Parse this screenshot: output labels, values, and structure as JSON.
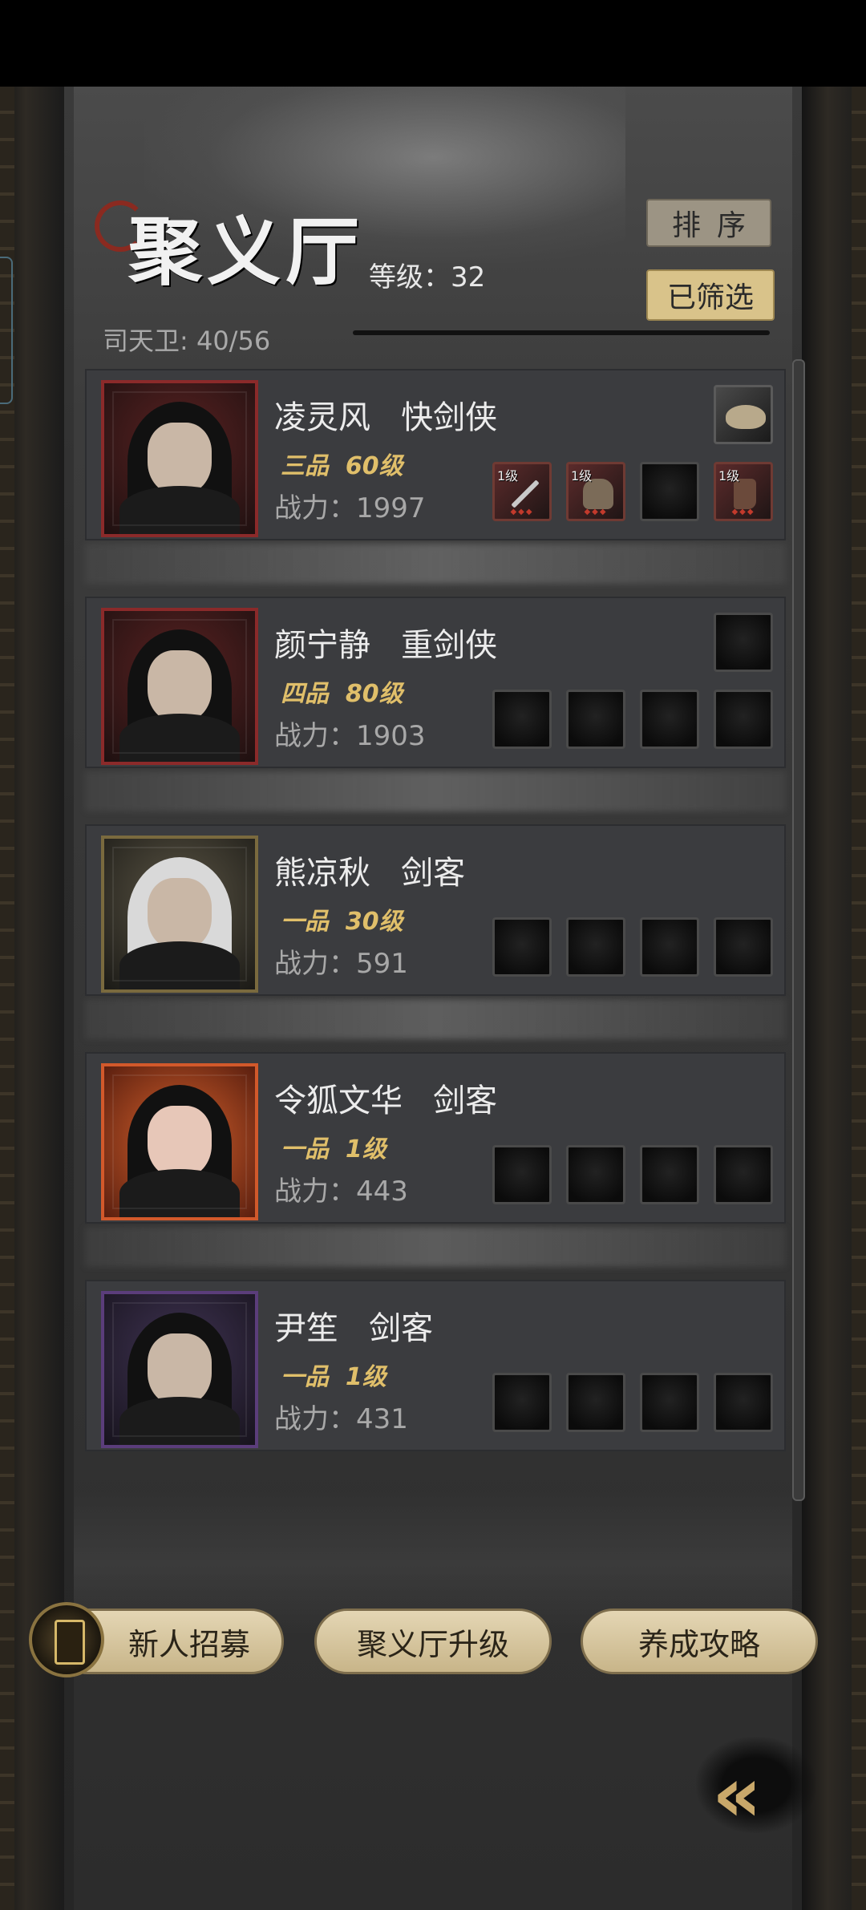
{
  "header": {
    "title": "聚义厅",
    "level_label": "等级：32",
    "guard_count": "司天卫: 40/56",
    "sort_label": "排序",
    "filter_label": "已筛选"
  },
  "heroes": [
    {
      "name": "凌灵风",
      "class": "快剑侠",
      "grade": "三品",
      "level": "60级",
      "power": "战力：1997",
      "frame_color": "#8b2a2a",
      "badge": "hat-icon",
      "slots": [
        {
          "filled": true,
          "level": "1级",
          "icon": "sword-icon"
        },
        {
          "filled": true,
          "level": "1级",
          "icon": "armor-icon"
        },
        {
          "filled": false,
          "level": "",
          "icon": ""
        },
        {
          "filled": true,
          "level": "1级",
          "icon": "boot-icon"
        }
      ]
    },
    {
      "name": "颜宁静",
      "class": "重剑侠",
      "grade": "四品",
      "level": "80级",
      "power": "战力：1903",
      "frame_color": "#8b2a2a",
      "badge": "",
      "slots": [
        {
          "filled": false,
          "level": "",
          "icon": ""
        },
        {
          "filled": false,
          "level": "",
          "icon": ""
        },
        {
          "filled": false,
          "level": "",
          "icon": ""
        },
        {
          "filled": false,
          "level": "",
          "icon": ""
        }
      ]
    },
    {
      "name": "熊凉秋",
      "class": "剑客",
      "grade": "一品",
      "level": "30级",
      "power": "战力：591",
      "frame_color": "#7a6a3e",
      "badge": null,
      "slots": [
        {
          "filled": false,
          "level": "",
          "icon": ""
        },
        {
          "filled": false,
          "level": "",
          "icon": ""
        },
        {
          "filled": false,
          "level": "",
          "icon": ""
        },
        {
          "filled": false,
          "level": "",
          "icon": ""
        }
      ]
    },
    {
      "name": "令狐文华",
      "class": "剑客",
      "grade": "一品",
      "level": "1级",
      "power": "战力：443",
      "frame_color": "#d2592b",
      "badge": null,
      "slots": [
        {
          "filled": false,
          "level": "",
          "icon": ""
        },
        {
          "filled": false,
          "level": "",
          "icon": ""
        },
        {
          "filled": false,
          "level": "",
          "icon": ""
        },
        {
          "filled": false,
          "level": "",
          "icon": ""
        }
      ]
    },
    {
      "name": "尹笙",
      "class": "剑客",
      "grade": "一品",
      "level": "1级",
      "power": "战力：431",
      "frame_color": "#5b3d7b",
      "badge": null,
      "slots": [
        {
          "filled": false,
          "level": "",
          "icon": ""
        },
        {
          "filled": false,
          "level": "",
          "icon": ""
        },
        {
          "filled": false,
          "level": "",
          "icon": ""
        },
        {
          "filled": false,
          "level": "",
          "icon": ""
        }
      ]
    }
  ],
  "bottom": {
    "recruit_label": "新人招募",
    "upgrade_label": "聚义厅升级",
    "guide_label": "养成攻略",
    "back_icon": "double-chevron-left-icon"
  },
  "colors": {
    "gold_text": "#e0bf6a",
    "button_beige": "#d9c38a"
  }
}
